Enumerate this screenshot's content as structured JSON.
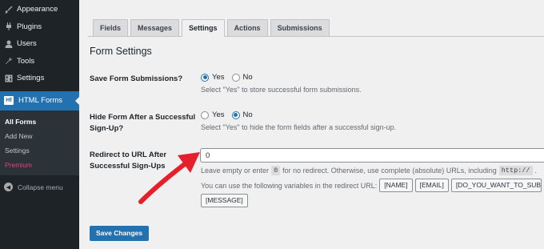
{
  "sidebar": {
    "items": [
      {
        "label": "Appearance",
        "icon": "paintbrush-icon"
      },
      {
        "label": "Plugins",
        "icon": "plugin-icon"
      },
      {
        "label": "Users",
        "icon": "users-icon"
      },
      {
        "label": "Tools",
        "icon": "wrench-icon"
      },
      {
        "label": "Settings",
        "icon": "settings-icon"
      }
    ],
    "active": {
      "label": "HTML Forms",
      "logo": "Hf"
    },
    "submenu": [
      "All Forms",
      "Add New",
      "Settings",
      "Premium"
    ],
    "collapse_label": "Collapse menu"
  },
  "tabs": [
    "Fields",
    "Messages",
    "Settings",
    "Actions",
    "Submissions"
  ],
  "section_title": "Form Settings",
  "save_submissions": {
    "label": "Save Form Submissions?",
    "yes": "Yes",
    "no": "No",
    "selected": "Yes",
    "desc": "Select \"Yes\" to store successful form submissions."
  },
  "hide_form": {
    "label_line1": "Hide Form After a Successful",
    "label_line2": "Sign-Up?",
    "yes": "Yes",
    "no": "No",
    "selected": "No",
    "desc": "Select \"Yes\" to hide the form fields after a successful sign-up."
  },
  "redirect": {
    "label_line1": "Redirect to URL After",
    "label_line2": "Successful Sign-Ups",
    "value": "0",
    "help_part1": "Leave empty or enter",
    "help_code": "0",
    "help_part2": "for no redirect. Otherwise, use complete (absolute) URLs, including",
    "help_code2": "http://",
    "help_end": ".",
    "vars_text": "You can use the following variables in the redirect URL:",
    "vars": [
      "[NAME]",
      "[EMAIL]",
      "[DO_YOU_WANT_TO_SUBSCRIBE]",
      "[MESSAGE]"
    ]
  },
  "save_button": "Save Changes",
  "colors": {
    "accent": "#2271b1",
    "sidebar": "#1d2327",
    "premium": "#e93c87",
    "arrow": "#e5202a"
  }
}
